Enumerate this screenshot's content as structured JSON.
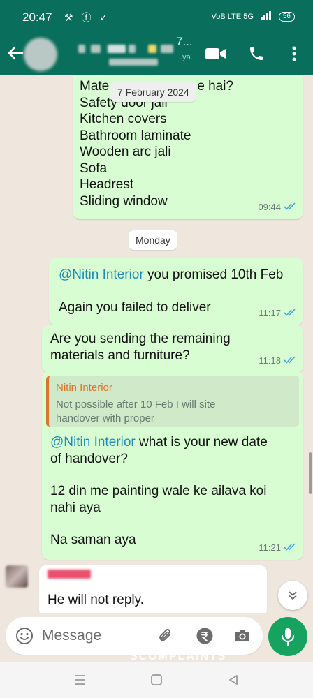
{
  "status_bar": {
    "time": "20:47",
    "left_icons": "⚒ ⓕ ✓",
    "network": "VoB LTE  5G",
    "battery": "56"
  },
  "header": {
    "contact_title": "7...",
    "contact_sub": "...ya..."
  },
  "date_float": "7 February 2024",
  "messages": [
    {
      "type": "out",
      "lines": [
        "Mate",
        "e hai?",
        "Safety door jali",
        "Kitchen covers",
        "Bathroom laminate",
        "Wooden arc jali",
        "Sofa",
        "Headrest",
        "Sliding window"
      ],
      "time": "09:44"
    },
    {
      "type": "out",
      "mention": "@Nitin Interior",
      "text1": " you promised 10th Feb",
      "text2": "Again you failed to deliver",
      "time": "11:17"
    },
    {
      "type": "out",
      "line1": "Are you sending the remaining",
      "line2": "materials and furniture?",
      "time": "11:18"
    },
    {
      "type": "out",
      "quote_author": "Nitin Interior",
      "quote_line1": "Not possible after 10 Feb I will site",
      "quote_line2": "handover with proper",
      "mention": "@Nitin Interior",
      "text1": " what is your new date",
      "text2": "of handover?",
      "text3": "12 din me painting wale ke ailava koi",
      "text4": "nahi aya",
      "text5": "Na saman aya",
      "time": "11:21"
    },
    {
      "type": "in",
      "text": "He will not reply."
    }
  ],
  "date_pill": "Monday",
  "composer": {
    "placeholder": "Message"
  },
  "watermark": "SCOMPLAINTS",
  "colors": {
    "header": "#0a6e5c",
    "outgoing": "#d8fdd2",
    "mention": "#1d8bb8",
    "quote_author": "#e0712a",
    "mic": "#16a35f",
    "tick": "#3aa6e0"
  },
  "icons": [
    "back-arrow-icon",
    "video-call-icon",
    "voice-call-icon",
    "more-options-icon",
    "double-check-icon",
    "chevron-down-icon",
    "emoji-icon",
    "attach-icon",
    "rupee-icon",
    "camera-icon",
    "mic-icon",
    "nav-menu-icon",
    "nav-home-icon",
    "nav-back-icon"
  ]
}
